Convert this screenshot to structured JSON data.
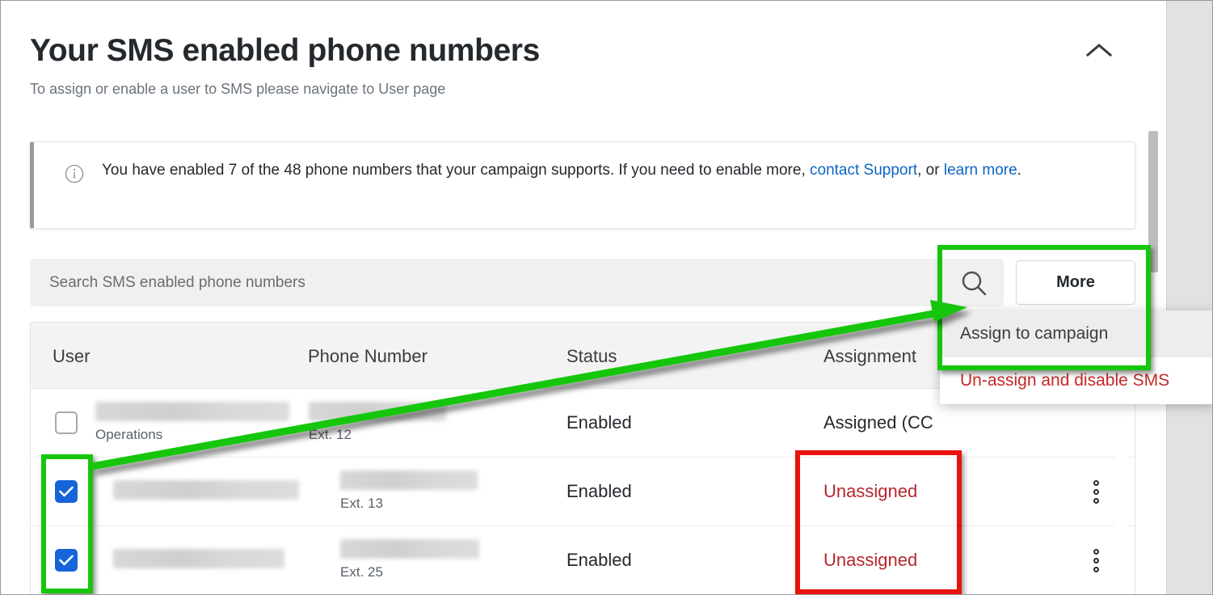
{
  "header": {
    "title": "Your SMS enabled phone numbers",
    "subtitle": "To assign or enable a user to SMS please navigate to User page",
    "collapse_icon": "chevron-up-icon"
  },
  "banner": {
    "icon": "info-icon",
    "text_part1": "You have enabled 7 of the 48 phone numbers that your campaign supports. If you need to enable more, ",
    "link1": "contact Support",
    "text_part2": ", or ",
    "link2": "learn more",
    "text_part3": ".",
    "enabled_count": "7",
    "total_count": "48",
    "accent_color": "#9a9a9a"
  },
  "toolbar": {
    "search_placeholder": "Search SMS enabled phone numbers",
    "search_value": "",
    "search_icon": "search-icon",
    "more_label": "More"
  },
  "dropdown": {
    "items": [
      {
        "label": "Assign to campaign",
        "state": "hovered",
        "danger": false
      },
      {
        "label": "Un-assign and disable SMS",
        "state": "normal",
        "danger": true
      }
    ]
  },
  "table": {
    "columns": [
      "User",
      "Phone Number",
      "Status",
      "Assignment"
    ],
    "rows": [
      {
        "selected": false,
        "user_name_redacted": true,
        "user_sub": "Operations",
        "phone_redacted": true,
        "extension": "Ext. 12",
        "status": "Enabled",
        "assignment": "Assigned (CC",
        "assignment_unassigned": false,
        "has_kebab": false
      },
      {
        "selected": true,
        "user_name_redacted": true,
        "user_sub": "",
        "phone_redacted": true,
        "extension": "Ext. 13",
        "status": "Enabled",
        "assignment": "Unassigned",
        "assignment_unassigned": true,
        "has_kebab": true
      },
      {
        "selected": true,
        "user_name_redacted": true,
        "user_sub": "",
        "phone_redacted": true,
        "extension": "Ext. 25",
        "status": "Enabled",
        "assignment": "Unassigned",
        "assignment_unassigned": true,
        "has_kebab": true
      }
    ]
  },
  "annotations": {
    "green_color": "#16c60c",
    "red_color": "#e8120e",
    "highlight_checkboxes": "green box around selected row checkboxes",
    "highlight_menu": "green box around More button and Assign to campaign item",
    "highlight_unassigned": "red box around Unassigned assignment cells",
    "arrow": "green arrow from checkbox column to Assign to campaign menu item"
  }
}
